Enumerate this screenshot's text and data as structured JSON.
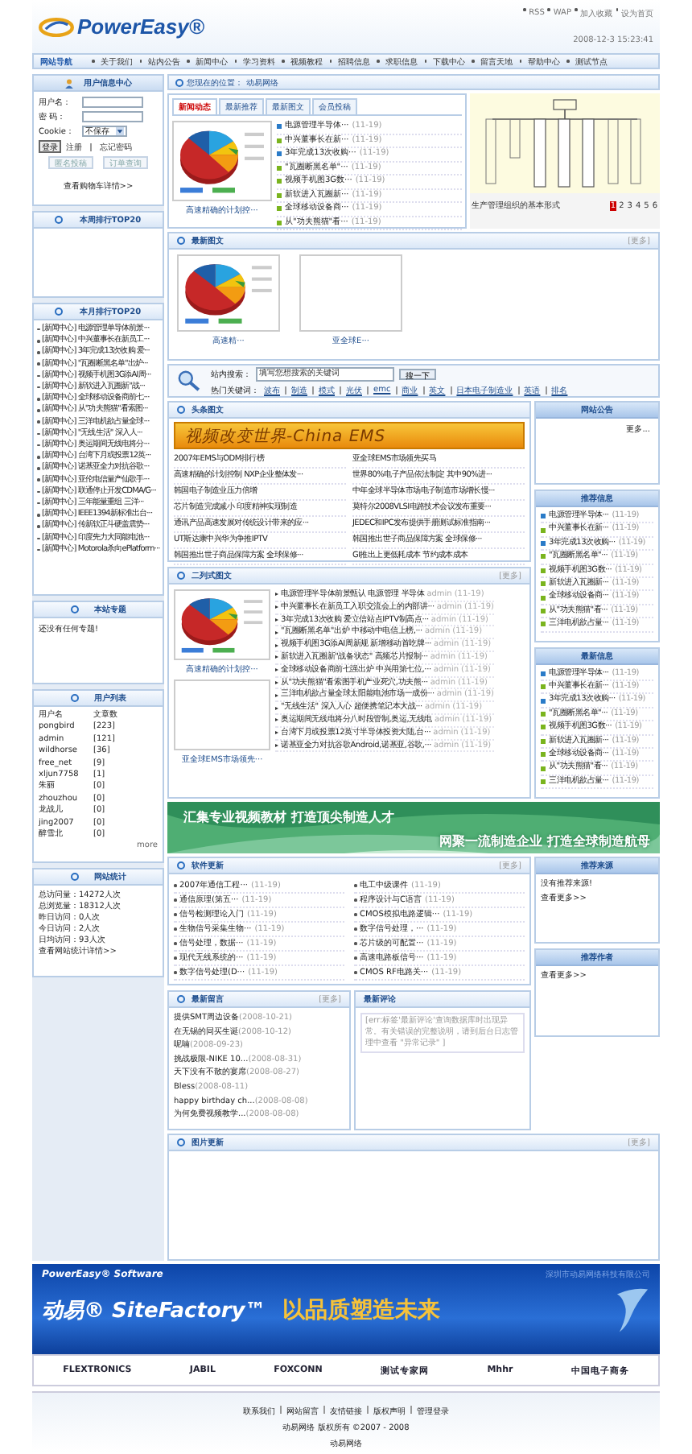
{
  "header": {
    "logo": "PowerEasy®",
    "top_links": [
      "RSS",
      "WAP",
      "加入收藏",
      "设为首页"
    ],
    "datetime": "2008-12-3 15:23:41"
  },
  "nav": {
    "title": "网站导航",
    "items": [
      "关于我们",
      "站内公告",
      "新闻中心",
      "学习资料",
      "视频教程",
      "招聘信息",
      "求职信息",
      "下载中心",
      "留言天地",
      "帮助中心",
      "测试节点"
    ]
  },
  "login": {
    "title": "用户信息中心",
    "fields": [
      {
        "label": "用户名："
      },
      {
        "label": "密 码："
      }
    ],
    "cookie": {
      "label": "Cookie：",
      "value": "不保存"
    },
    "button": "登录",
    "links": [
      "注册",
      "忘记密码"
    ],
    "buttons": [
      "匿名投稿",
      "订单查询"
    ],
    "cart_link": "查看购物车详情>>"
  },
  "weekly_top": {
    "title": "本周排行TOP20"
  },
  "monthly_top": {
    "title": "本月排行TOP20",
    "items": [
      {
        "category": "[新闻中心]",
        "title": "电源管理单导体前景···"
      },
      {
        "category": "[新闻中心]",
        "title": "中兴董事长在新员工···"
      },
      {
        "category": "[新闻中心]",
        "title": "3年完成13次收购 爱···"
      },
      {
        "category": "[新闻中心]",
        "title": "\"瓦圈断黑名单\"出炉···"
      },
      {
        "category": "[新闻中心]",
        "title": "视频手机图3G添AI周···"
      },
      {
        "category": "[新闻中心]",
        "title": "新软进入瓦圈新\"战···"
      },
      {
        "category": "[新闻中心]",
        "title": "全球移动设备商前七···"
      },
      {
        "category": "[新闻中心]",
        "title": "从\"功夫熊猫\"看索图···"
      },
      {
        "category": "[新闻中心]",
        "title": "三洋电机欲占量全球···"
      },
      {
        "category": "[新闻中心]",
        "title": "\"无线生活\" 深入人···"
      },
      {
        "category": "[新闻中心]",
        "title": "奥运期间无线电将分···"
      },
      {
        "category": "[新闻中心]",
        "title": "台湾下月或投票12英···"
      },
      {
        "category": "[新闻中心]",
        "title": "诺基亚全力对抗谷歌···"
      },
      {
        "category": "[新闻中心]",
        "title": "亚伦电信量产仙歌手···"
      },
      {
        "category": "[新闻中心]",
        "title": "联通停止开发CDMA/G···"
      },
      {
        "category": "[新闻中心]",
        "title": "三年能量重组 三洋···"
      },
      {
        "category": "[新闻中心]",
        "title": "IEEE1394新标准出台···"
      },
      {
        "category": "[新闻中心]",
        "title": "传新软正斗硬盖震势···"
      },
      {
        "category": "[新闻中心]",
        "title": "印度先力大同能电池···"
      },
      {
        "category": "[新闻中心]",
        "title": "Motorola杀向ePlatform···"
      }
    ]
  },
  "topics": {
    "title": "本站专题",
    "text": "还没有任何专题!"
  },
  "users": {
    "title": "用户列表",
    "header": [
      "用户名",
      "文章数"
    ],
    "rows": [
      {
        "name": "pongbird",
        "count": "[223]"
      },
      {
        "name": "admin",
        "count": "[121]"
      },
      {
        "name": "wildhorse",
        "count": "[36]"
      },
      {
        "name": "free_net",
        "count": "[9]"
      },
      {
        "name": "xljun7758",
        "count": "[1]"
      },
      {
        "name": "朱丽",
        "count": "[0]"
      },
      {
        "name": "zhouzhou",
        "count": "[0]"
      },
      {
        "name": "龙战儿",
        "count": "[0]"
      },
      {
        "name": "jing2007",
        "count": "[0]"
      },
      {
        "name": "醉雪北",
        "count": "[0]"
      }
    ],
    "more": "more"
  },
  "stats": {
    "title": "网站统计",
    "lines": [
      "总访问量：14272人次",
      "总浏览量：18312人次",
      "昨日访问：0人次",
      "今日访问：2人次",
      "日均访问：93人次"
    ],
    "link": "查看网站统计详情>>"
  },
  "breadcrumb": {
    "label": "您现在的位置：",
    "link": "动易网络"
  },
  "tab_box": {
    "tabs": [
      {
        "label": "新闻动态",
        "selected": true
      },
      {
        "label": "最新推荐",
        "selected": false
      },
      {
        "label": "最新图文",
        "selected": false
      },
      {
        "label": "会员投稿",
        "selected": false
      }
    ],
    "caption": "高速精确的计划控···",
    "items": [
      {
        "title": "电源管理半导体···",
        "date": "(11-19)",
        "color": "#2a7bc8"
      },
      {
        "title": "中兴董事长在新···",
        "date": "(11-19)",
        "color": "#7ab41e"
      },
      {
        "title": "3年完成13次收购···",
        "date": "(11-19)",
        "color": "#2a7bc8"
      },
      {
        "title": "\"瓦圈断黑名单\"···",
        "date": "(11-19)",
        "color": "#7ab41e"
      },
      {
        "title": "视频手机图3G数···",
        "date": "(11-19)",
        "color": "#7ab41e"
      },
      {
        "title": "新软进入瓦圈新···",
        "date": "(11-19)",
        "color": "#7ab41e"
      },
      {
        "title": "全球移动设备商···",
        "date": "(11-19)",
        "color": "#7ab41e"
      },
      {
        "title": "从\"功夫熊猫\"看···",
        "date": "(11-19)",
        "color": "#7ab41e"
      }
    ]
  },
  "slideshow": {
    "caption": "生产管理组织的基本形式",
    "pages": [
      {
        "label": "1",
        "selected": true
      },
      {
        "label": "2",
        "selected": false
      },
      {
        "label": "3",
        "selected": false
      },
      {
        "label": "4",
        "selected": false
      },
      {
        "label": "5",
        "selected": false
      },
      {
        "label": "6",
        "selected": false
      }
    ]
  },
  "latest_pictures": {
    "title": "最新图文",
    "more": "[更多]",
    "items": [
      {
        "kind": "picture",
        "caption": "高速精···"
      },
      {
        "kind": "empty",
        "caption": "亚全球E···"
      }
    ]
  },
  "search": {
    "label": "站内搜索：",
    "placeholder": "填写您想搜索的关键词",
    "button": "搜一下",
    "hot_label": "热门关键词：",
    "keywords": [
      "波布",
      "制造",
      "模式",
      "光伏",
      "emc",
      "商业",
      "英文",
      "日本电子制造业",
      "英语",
      "排名"
    ]
  },
  "headline": {
    "title": "头条图文",
    "banner": "视频改变世界-China EMS",
    "rows": [
      {
        "left": "2007年EMS与ODM排行榜",
        "right": "亚全球EMS市场领先买马"
      },
      {
        "left": "高速精确的计划控制 NXP企业整体发···",
        "right": "世界80%电子产品依法制定 其中90%进···"
      },
      {
        "left": "韩国电子制造业压力倍增",
        "right": "中年全球半导体市场电子制造市场增长慢···"
      },
      {
        "left": "芯片制造完成减小 印度精神实现制造",
        "right": "莫特尔2008VLSI电路技术会议发布重要···"
      },
      {
        "left": "通讯产品高速发展对传统设计带来的应···",
        "right": "JEDEC和IPC发布提供手册测试标准指南···"
      },
      {
        "left": "UT斯达康中兴华为争推IPTV",
        "right": "韩国推出世子商品保障方案 全球保修···"
      },
      {
        "left": "韩国推出世子商品保障方案 全球保修···",
        "right": "GI推出上更低耗成本 节约成本成本"
      }
    ]
  },
  "two_column": {
    "title": "二列式图文",
    "more": "[更多]",
    "pictures": [
      {
        "kind": "picture",
        "caption": "高速精确的计划控···"
      },
      {
        "kind": "empty",
        "caption": "亚全球EMS市场领先···"
      }
    ],
    "items": [
      {
        "title": "电源管理半导体前景甄认 电源管理 半导体",
        "author": "admin",
        "date": "(11-19)"
      },
      {
        "title": "中兴董事长在新员工入职交流会上的内部讲···",
        "author": "admin",
        "date": "(11-19)"
      },
      {
        "title": "3年完成13次收购 爱立信站点IPTV制高点···",
        "author": "admin",
        "date": "(11-19)"
      },
      {
        "title": "\"瓦圈断黑名单\"出炉 中移动中电信上榜,···",
        "author": "admin",
        "date": "(11-19)"
      },
      {
        "title": "视频手机图3G添AI周新规 新增移动首吃牌···",
        "author": "admin",
        "date": "(11-19)"
      },
      {
        "title": "新软进入瓦圈新\"战备状态\" 高频芯片报制···",
        "author": "admin",
        "date": "(11-19)"
      },
      {
        "title": "全球移动设备商前七强出炉 中兴用第七位,···",
        "author": "admin",
        "date": "(11-19)"
      },
      {
        "title": "从\"功夫熊猫\"看索图手机产业死穴,功夫熊···",
        "author": "admin",
        "date": "(11-19)"
      },
      {
        "title": "三洋电机欲占量全球太阳能电池市场一成份···",
        "author": "admin",
        "date": "(11-19)"
      },
      {
        "title": "\"无线生活\" 深入人心 超便携笔记本大战···",
        "author": "admin",
        "date": "(11-19)"
      },
      {
        "title": "奥运期间无线电将分八时段管制,奥运,无线电",
        "author": "admin",
        "date": "(11-19)"
      },
      {
        "title": "台湾下月或投票12英寸半导体投资大陆,台···",
        "author": "admin",
        "date": "(11-19)"
      },
      {
        "title": "诺基亚全力对抗谷歌Android,诺基亚,谷歌,···",
        "author": "admin",
        "date": "(11-19)"
      }
    ]
  },
  "notice": {
    "title": "网站公告",
    "more": "更多..."
  },
  "recommended": {
    "title": "推荐信息",
    "items": [
      {
        "title": "电源管理半导体···",
        "date": "(11-19)",
        "color": "#2a7bc8"
      },
      {
        "title": "中兴董事长在新···",
        "date": "(11-19)",
        "color": "#7ab41e"
      },
      {
        "title": "3年完成13次收购···",
        "date": "(11-19)",
        "color": "#2a7bc8"
      },
      {
        "title": "\"瓦圈断黑名单\"···",
        "date": "(11-19)",
        "color": "#7ab41e"
      },
      {
        "title": "视频手机图3G数···",
        "date": "(11-19)",
        "color": "#7ab41e"
      },
      {
        "title": "新软进入瓦圈新···",
        "date": "(11-19)",
        "color": "#7ab41e"
      },
      {
        "title": "全球移动设备商···",
        "date": "(11-19)",
        "color": "#7ab41e"
      },
      {
        "title": "从\"功夫熊猫\"看···",
        "date": "(11-19)",
        "color": "#7ab41e"
      },
      {
        "title": "三洋电机欲占量···",
        "date": "(11-19)",
        "color": "#7ab41e"
      }
    ]
  },
  "latest_info": {
    "title": "最新信息",
    "items": [
      {
        "title": "电源管理半导体···",
        "date": "(11-19)",
        "color": "#2a7bc8"
      },
      {
        "title": "中兴董事长在新···",
        "date": "(11-19)",
        "color": "#7ab41e"
      },
      {
        "title": "3年完成13次收购···",
        "date": "(11-19)",
        "color": "#2a7bc8"
      },
      {
        "title": "\"瓦圈断黑名单\"···",
        "date": "(11-19)",
        "color": "#7ab41e"
      },
      {
        "title": "视频手机图3G数···",
        "date": "(11-19)",
        "color": "#7ab41e"
      },
      {
        "title": "新软进入瓦圈新···",
        "date": "(11-19)",
        "color": "#7ab41e"
      },
      {
        "title": "全球移动设备商···",
        "date": "(11-19)",
        "color": "#7ab41e"
      },
      {
        "title": "从\"功夫熊猫\"看···",
        "date": "(11-19)",
        "color": "#7ab41e"
      },
      {
        "title": "三洋电机欲占量···",
        "date": "(11-19)",
        "color": "#7ab41e"
      }
    ]
  },
  "promo_banner": {
    "lines": [
      "汇集专业视频教材 打造顶尖制造人才",
      "网聚一流制造企业 打造全球制造航母"
    ]
  },
  "software": {
    "title": "软件更新",
    "more": "[更多]",
    "items": [
      {
        "title": "2007年通信工程···",
        "date": "(11-19)"
      },
      {
        "title": "电工中级课件",
        "date": "(11-19)"
      },
      {
        "title": "通信原理(第五···",
        "date": "(11-19)"
      },
      {
        "title": "程序设计与C语言",
        "date": "(11-19)"
      },
      {
        "title": "信号检测理论入门",
        "date": "(11-19)"
      },
      {
        "title": "CMOS模拟电路逻辑···",
        "date": "(11-19)"
      },
      {
        "title": "生物信号采集生物···",
        "date": "(11-19)"
      },
      {
        "title": "数字信号处理，···",
        "date": "(11-19)"
      },
      {
        "title": "信号处理，数据···",
        "date": "(11-19)"
      },
      {
        "title": "芯片级的可配置···",
        "date": "(11-19)"
      },
      {
        "title": "现代无线系统的···",
        "date": "(11-19)"
      },
      {
        "title": "高速电路板信号···",
        "date": "(11-19)"
      },
      {
        "title": "数字信号处理(D···",
        "date": "(11-19)"
      },
      {
        "title": "CMOS RF电路关···",
        "date": "(11-19)"
      }
    ]
  },
  "sources": {
    "title": "推荐来源",
    "text": "没有推荐来源!",
    "more": "查看更多>>"
  },
  "authors": {
    "title": "推荐作者",
    "more": "查看更多>>"
  },
  "guestbook": {
    "title": "最新留言",
    "more": "[更多]",
    "items": [
      {
        "title": "提供SMT周边设备",
        "date": "(2008-10-21)"
      },
      {
        "title": "在无锡的同买生诞",
        "date": "(2008-10-12)"
      },
      {
        "title": "呢喃",
        "date": "(2008-09-23)"
      },
      {
        "title": "挑战极限-NIKE 10...",
        "date": "(2008-08-31)"
      },
      {
        "title": "天下没有不散的宴席",
        "date": "(2008-08-27)"
      },
      {
        "title": "Bless",
        "date": "(2008-08-11)"
      },
      {
        "title": "happy birthday ch...",
        "date": "(2008-08-08)"
      },
      {
        "title": "为何免费视频教学...",
        "date": "(2008-08-08)"
      }
    ]
  },
  "comments": {
    "title": "最新评论",
    "text": "[err:标签'最新评论'查询数据库时出现异常。有关错误的完整说明，请到后台日志管理中查看 \"异常记录\" ]"
  },
  "photos": {
    "title": "图片更新",
    "more": "[更多]"
  },
  "footer_banner": {
    "brand": "PowerEasy®",
    "brand_suffix": "Software",
    "company": "深圳市动易网络科技有限公司",
    "product": "动易® SiteFactory™",
    "slogan": "以品质塑造未来"
  },
  "partners": [
    "FLEXTRONICS",
    "JABIL",
    "FOXCONN",
    "测试专家网",
    "Mhhr",
    "中国电子商务"
  ],
  "footer": {
    "links": [
      "联系我们",
      "网站留言",
      "友情链接",
      "版权声明",
      "管理登录"
    ],
    "copyright": "动易网络 版权所有 ©2007 - 2008",
    "owner": "动易网络"
  }
}
